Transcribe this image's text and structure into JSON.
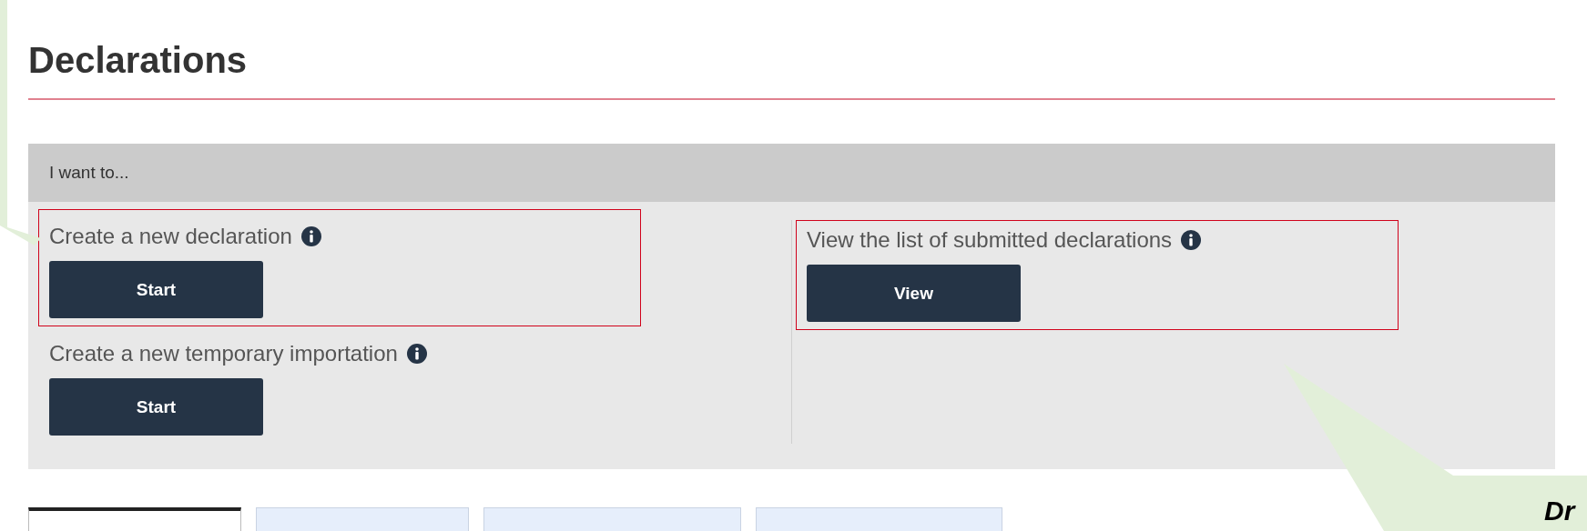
{
  "page": {
    "title": "Declarations"
  },
  "panel": {
    "header": "I want to...",
    "columns": [
      {
        "options": [
          {
            "label": "Create a new declaration",
            "button": "Start",
            "highlighted": true
          },
          {
            "label": "Create a new temporary importation",
            "button": "Start",
            "highlighted": false
          }
        ]
      },
      {
        "options": [
          {
            "label": "View the list of submitted declarations",
            "button": "View",
            "highlighted": true
          }
        ]
      }
    ]
  },
  "tabs": [
    {
      "selected": true
    },
    {
      "selected": false
    },
    {
      "selected": false
    },
    {
      "selected": false
    }
  ],
  "callout": {
    "text": "Dr"
  }
}
